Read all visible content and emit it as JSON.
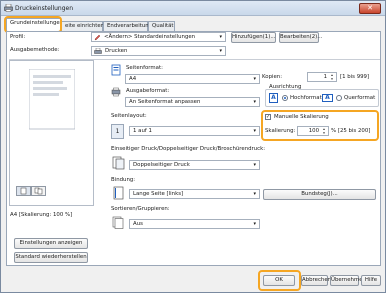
{
  "window": {
    "title": "Druckeinstellungen",
    "close_glyph": "✕"
  },
  "tabs": [
    {
      "label": "Grundeinstellungen"
    },
    {
      "label": "eite einrichten"
    },
    {
      "label": "Endverarbeitung"
    },
    {
      "label": "Qualität"
    }
  ],
  "profile": {
    "label": "Profil:",
    "value": "<Ändern> Standardeinstellungen",
    "add_button": "Hinzufügen(1)...",
    "edit_button": "Bearbeiten(2)..."
  },
  "output": {
    "label": "Ausgabemethode:",
    "value": "Drucken"
  },
  "preview": {
    "caption": "A4 [Skalierung: 100 %]"
  },
  "left_buttons": {
    "show_settings": "Einstellungen anzeigen",
    "restore_defaults": "Standard wiederherstellen"
  },
  "page_format": {
    "label": "Seitenformat:",
    "value": "A4"
  },
  "output_format": {
    "label": "Ausgabeformat:",
    "value": "An Seitenformat anpassen"
  },
  "page_layout": {
    "label": "Seitenlayout:",
    "value": "1 auf 1",
    "icon_digit": "1"
  },
  "duplex": {
    "label": "Einseitiger Druck/Doppelseitiger Druck/Broschürendruck:",
    "value": "Doppelseitiger Druck"
  },
  "binding": {
    "label": "Bindung:",
    "value": "Lange Seite [links]"
  },
  "collate": {
    "label": "Sortieren/Gruppieren:",
    "value": "Aus"
  },
  "copies": {
    "label": "Kopien:",
    "value": "1",
    "range": "[1 bis 999]"
  },
  "orientation": {
    "label": "Ausrichtung",
    "portrait": "Hochformat",
    "landscape": "Querformat",
    "letter": "A"
  },
  "scaling": {
    "checkbox_label": "Manuelle Skalierung",
    "checked": true,
    "label": "Skalierung:",
    "value": "100",
    "range": "% [25 bis 200]"
  },
  "gutter_button": "Bundsteg(J)...",
  "footer": {
    "ok": "OK",
    "cancel": "Abbrechen",
    "apply": "Übernehmen",
    "help": "Hilfe"
  },
  "icons": {
    "check": "✓",
    "arrow_down": "▾",
    "arrow_up": "▴"
  },
  "colors": {
    "highlight": "#f5a623",
    "accent": "#1f5fbf"
  }
}
